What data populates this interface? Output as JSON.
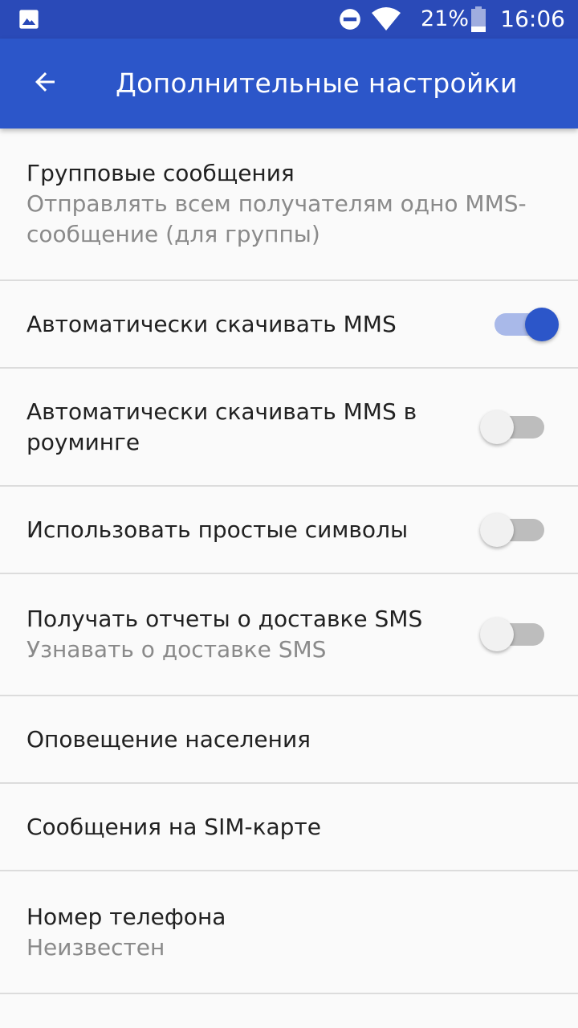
{
  "status_bar": {
    "battery_percent": "21%",
    "time": "16:06",
    "icons": [
      "gallery-icon",
      "do-not-disturb-icon",
      "wifi-icon",
      "battery-icon"
    ]
  },
  "app_bar": {
    "title": "Дополнительные настройки",
    "back_icon": "arrow-back-icon",
    "color": "#2c56c9"
  },
  "settings": [
    {
      "title": "Групповые сообщения",
      "summary": "Отправлять всем получателям одно MMS-сообщение (для группы)",
      "toggle": null
    },
    {
      "title": "Автоматически скачивать MMS",
      "summary": "",
      "toggle": true
    },
    {
      "title": "Автоматически скачивать MMS в роуминге",
      "summary": "",
      "toggle": false
    },
    {
      "title": "Использовать простые символы",
      "summary": "",
      "toggle": false
    },
    {
      "title": "Получать отчеты о доставке SMS",
      "summary": "Узнавать о доставке SMS",
      "toggle": false
    },
    {
      "title": "Оповещение населения",
      "summary": "",
      "toggle": null
    },
    {
      "title": "Сообщения на SIM-карте",
      "summary": "",
      "toggle": null
    },
    {
      "title": "Номер телефона",
      "summary": "Неизвестен",
      "toggle": null
    }
  ]
}
